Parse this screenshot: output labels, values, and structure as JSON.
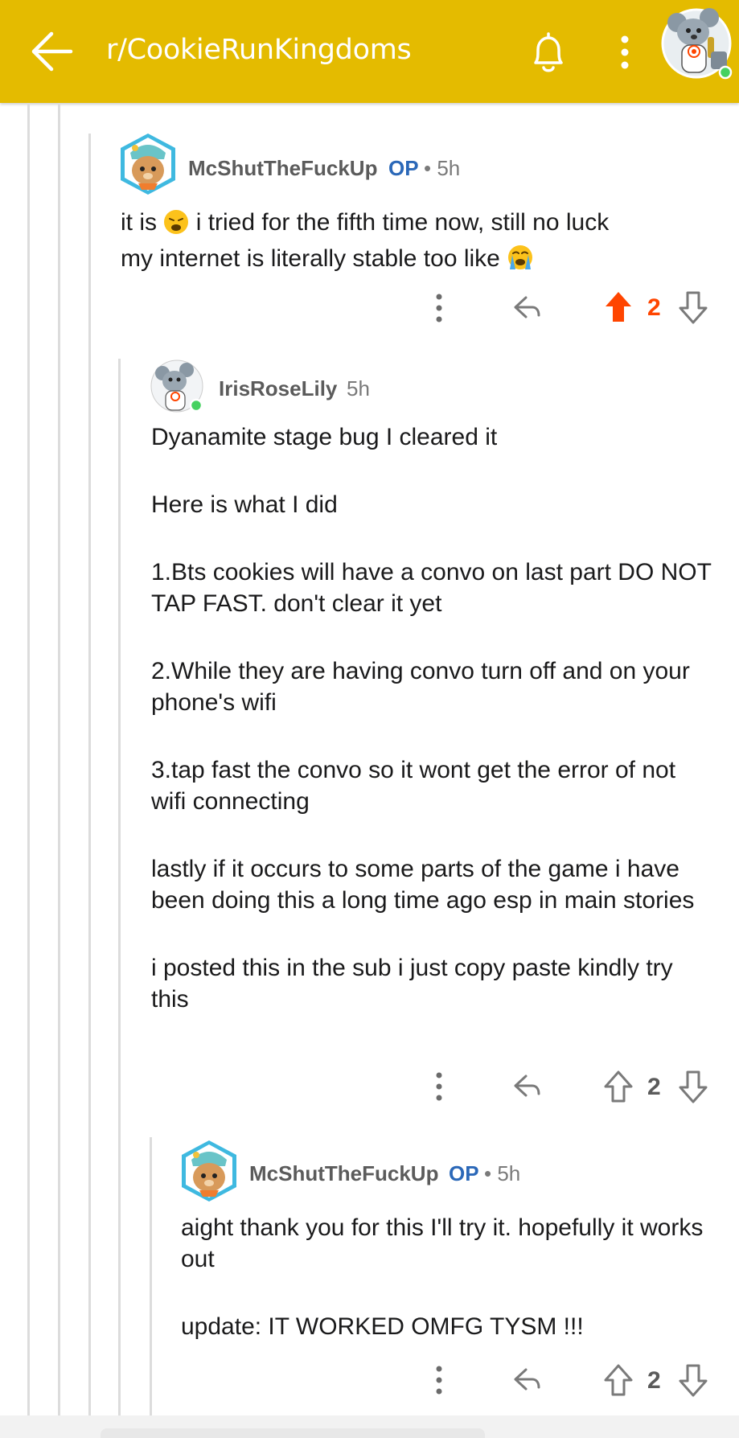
{
  "header": {
    "subreddit": "r/CookieRunKingdoms",
    "back_icon": "arrow-left-icon",
    "bell_icon": "bell-icon",
    "more_icon": "vertical-dots-icon",
    "bar_color": "#e4bb00"
  },
  "comments": [
    {
      "author": "McShutTheFuckUp",
      "op_label": "OP",
      "time": "• 5h",
      "lines": [
        "it is",
        "i tried for the fifth time now, still no luck",
        "my internet is literally stable too like"
      ],
      "emojis": [
        "weary-face-emoji",
        "loudly-crying-face-emoji"
      ],
      "votes": "2",
      "upvoted": true
    },
    {
      "author": "IrisRoseLily",
      "time": "5h",
      "paragraphs": [
        "Dyanamite stage bug I cleared it",
        "Here is what I did",
        "1.Bts cookies will have a convo on last part DO NOT TAP FAST. don't clear it yet",
        "2.While they are having convo turn off and on your phone's wifi",
        "3.tap fast the convo so it wont get the error of not wifi connecting",
        "lastly if it occurs to some parts of the game i have been doing this a long time ago esp in main stories",
        "i posted this in the sub i just copy paste kindly try this"
      ],
      "votes": "2",
      "upvoted": false
    },
    {
      "author": "McShutTheFuckUp",
      "op_label": "OP",
      "time": "• 5h",
      "paragraphs": [
        "aight thank you for this I'll try it. hopefully it works out",
        "update: IT WORKED OMFG TYSM !!!"
      ],
      "votes": "2",
      "upvoted": false
    }
  ],
  "colors": {
    "upvote_active": "#ff4500",
    "op_blue": "#2b68b8",
    "online_green": "#46d160"
  }
}
